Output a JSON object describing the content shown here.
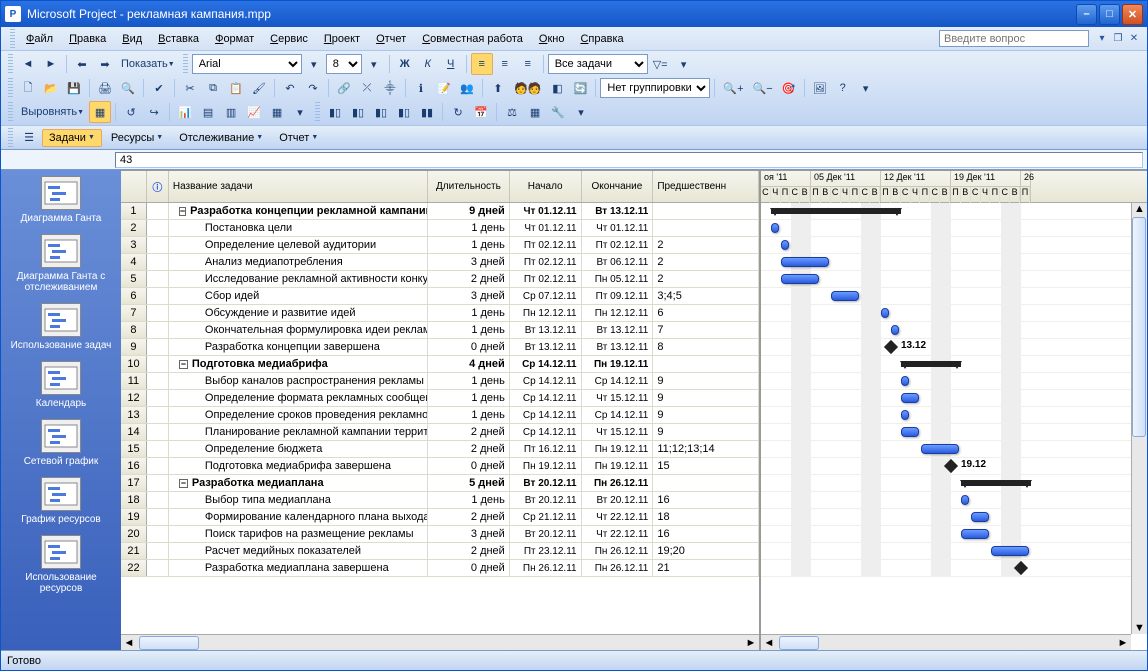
{
  "window": {
    "title": "Microsoft Project  - рекламная кампания.mpp"
  },
  "menu": {
    "items": [
      "Файл",
      "Правка",
      "Вид",
      "Вставка",
      "Формат",
      "Сервис",
      "Проект",
      "Отчет",
      "Совместная работа",
      "Окно",
      "Справка"
    ],
    "help_placeholder": "Введите вопрос"
  },
  "toolbar": {
    "show_label": "Показать",
    "font_name": "Arial",
    "font_size": "8",
    "task_filter": "Все задачи",
    "group_filter": "Нет группировки",
    "align_label": "Выровнять"
  },
  "viewbar": {
    "items": [
      "Задачи",
      "Ресурсы",
      "Отслеживание",
      "Отчет"
    ]
  },
  "cell_input": "43",
  "sidebar": {
    "items": [
      {
        "label": "Диаграмма Ганта"
      },
      {
        "label": "Диаграмма Ганта с отслеживанием"
      },
      {
        "label": "Использование задач"
      },
      {
        "label": "Календарь"
      },
      {
        "label": "Сетевой график"
      },
      {
        "label": "График ресурсов"
      },
      {
        "label": "Использование ресурсов"
      }
    ]
  },
  "grid": {
    "headers": {
      "info": "",
      "name": "Название задачи",
      "duration": "Длительность",
      "start": "Начало",
      "end": "Окончание",
      "pred": "Предшественн"
    },
    "col_widths": {
      "row": 26,
      "info": 22,
      "name": 260,
      "dur": 82,
      "start": 72,
      "end": 72,
      "pred": 106
    },
    "rows": [
      {
        "n": 1,
        "summary": true,
        "indent": 0,
        "outline": "-",
        "name": "Разработка концепции рекламной кампании",
        "dur": "9 дней",
        "start": "Чт 01.12.11",
        "end": "Вт 13.12.11",
        "pred": ""
      },
      {
        "n": 2,
        "indent": 1,
        "name": "Постановка цели",
        "dur": "1 день",
        "start": "Чт 01.12.11",
        "end": "Чт 01.12.11",
        "pred": ""
      },
      {
        "n": 3,
        "indent": 1,
        "name": "Определение целевой аудитории",
        "dur": "1 день",
        "start": "Пт 02.12.11",
        "end": "Пт 02.12.11",
        "pred": "2"
      },
      {
        "n": 4,
        "indent": 1,
        "name": "Анализ медиапотребления",
        "dur": "3 дней",
        "start": "Пт 02.12.11",
        "end": "Вт 06.12.11",
        "pred": "2"
      },
      {
        "n": 5,
        "indent": 1,
        "name": "Исследование рекламной активности конкур",
        "dur": "2 дней",
        "start": "Пт 02.12.11",
        "end": "Пн 05.12.11",
        "pred": "2"
      },
      {
        "n": 6,
        "indent": 1,
        "name": "Сбор идей",
        "dur": "3 дней",
        "start": "Ср 07.12.11",
        "end": "Пт 09.12.11",
        "pred": "3;4;5"
      },
      {
        "n": 7,
        "indent": 1,
        "name": "Обсуждение и развитие идей",
        "dur": "1 день",
        "start": "Пн 12.12.11",
        "end": "Пн 12.12.11",
        "pred": "6"
      },
      {
        "n": 8,
        "indent": 1,
        "name": "Окончательная формулировка идеи рекламно",
        "dur": "1 день",
        "start": "Вт 13.12.11",
        "end": "Вт 13.12.11",
        "pred": "7"
      },
      {
        "n": 9,
        "milestone": true,
        "indent": 1,
        "name": "Разработка концепции завершена",
        "dur": "0 дней",
        "start": "Вт 13.12.11",
        "end": "Вт 13.12.11",
        "pred": "8"
      },
      {
        "n": 10,
        "summary": true,
        "indent": 0,
        "outline": "-",
        "name": "Подготовка медиабрифа",
        "dur": "4 дней",
        "start": "Ср 14.12.11",
        "end": "Пн 19.12.11",
        "pred": ""
      },
      {
        "n": 11,
        "indent": 1,
        "name": "Выбор каналов распространения рекламы",
        "dur": "1 день",
        "start": "Ср 14.12.11",
        "end": "Ср 14.12.11",
        "pred": "9"
      },
      {
        "n": 12,
        "indent": 1,
        "name": "Определение формата рекламных сообщений",
        "dur": "1 день",
        "start": "Ср 14.12.11",
        "end": "Чт 15.12.11",
        "pred": "9"
      },
      {
        "n": 13,
        "indent": 1,
        "name": "Определение сроков проведения рекламной к",
        "dur": "1 день",
        "start": "Ср 14.12.11",
        "end": "Ср 14.12.11",
        "pred": "9"
      },
      {
        "n": 14,
        "indent": 1,
        "name": "Планирование рекламной кампании территор",
        "dur": "2 дней",
        "start": "Ср 14.12.11",
        "end": "Чт 15.12.11",
        "pred": "9"
      },
      {
        "n": 15,
        "indent": 1,
        "name": "Определение бюджета",
        "dur": "2 дней",
        "start": "Пт 16.12.11",
        "end": "Пн 19.12.11",
        "pred": "11;12;13;14"
      },
      {
        "n": 16,
        "milestone": true,
        "indent": 1,
        "name": "Подготовка медиабрифа завершена",
        "dur": "0 дней",
        "start": "Пн 19.12.11",
        "end": "Пн 19.12.11",
        "pred": "15"
      },
      {
        "n": 17,
        "summary": true,
        "indent": 0,
        "outline": "-",
        "name": "Разработка медиаплана",
        "dur": "5 дней",
        "start": "Вт 20.12.11",
        "end": "Пн 26.12.11",
        "pred": ""
      },
      {
        "n": 18,
        "indent": 1,
        "name": "Выбор типа медиаплана",
        "dur": "1 день",
        "start": "Вт 20.12.11",
        "end": "Вт 20.12.11",
        "pred": "16"
      },
      {
        "n": 19,
        "indent": 1,
        "name": "Формирование календарного плана выхода р",
        "dur": "2 дней",
        "start": "Ср 21.12.11",
        "end": "Чт 22.12.11",
        "pred": "18"
      },
      {
        "n": 20,
        "indent": 1,
        "name": "Поиск тарифов на размещение рекламы",
        "dur": "3 дней",
        "start": "Вт 20.12.11",
        "end": "Чт 22.12.11",
        "pred": "16"
      },
      {
        "n": 21,
        "indent": 1,
        "name": "Расчет медийных показателей",
        "dur": "2 дней",
        "start": "Пт 23.12.11",
        "end": "Пн 26.12.11",
        "pred": "19;20"
      },
      {
        "n": 22,
        "milestone": true,
        "indent": 1,
        "name": "Разработка медиаплана завершена",
        "dur": "0 дней",
        "start": "Пн 26.12.11",
        "end": "Пн 26.12.11",
        "pred": "21"
      }
    ]
  },
  "gantt": {
    "day_width": 10,
    "origin": "2011-11-30",
    "weeks": [
      {
        "label": "оя '11",
        "days": [
          "С",
          "Ч",
          "П",
          "С",
          "В"
        ]
      },
      {
        "label": "05 Дек '11",
        "days": [
          "П",
          "В",
          "С",
          "Ч",
          "П",
          "С",
          "В"
        ]
      },
      {
        "label": "12 Дек '11",
        "days": [
          "П",
          "В",
          "С",
          "Ч",
          "П",
          "С",
          "В"
        ]
      },
      {
        "label": "19 Дек '11",
        "days": [
          "П",
          "В",
          "С",
          "Ч",
          "П",
          "С",
          "В"
        ]
      },
      {
        "label": "26",
        "days": [
          "П"
        ]
      }
    ],
    "milestone_labels": {
      "9": "13.12",
      "16": "19.12"
    },
    "weekends": [
      [
        3,
        2
      ],
      [
        10,
        2
      ],
      [
        17,
        2
      ],
      [
        24,
        2
      ]
    ]
  },
  "status": {
    "text": "Готово"
  }
}
